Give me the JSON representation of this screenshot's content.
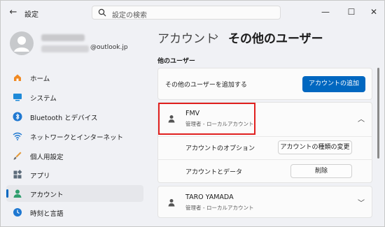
{
  "titlebar": {
    "back_label": "←",
    "app_title": "設定",
    "search_placeholder": "設定の検索",
    "minimize": "—",
    "maximize": "☐",
    "close": "✕"
  },
  "profile": {
    "email_domain": "@outlook.jp"
  },
  "sidebar": {
    "items": [
      {
        "label": "ホーム",
        "icon": "home-icon"
      },
      {
        "label": "システム",
        "icon": "system-icon"
      },
      {
        "label": "Bluetooth とデバイス",
        "icon": "bluetooth-icon"
      },
      {
        "label": "ネットワークとインターネット",
        "icon": "wifi-icon"
      },
      {
        "label": "個人用設定",
        "icon": "brush-icon"
      },
      {
        "label": "アプリ",
        "icon": "apps-icon"
      },
      {
        "label": "アカウント",
        "icon": "account-icon",
        "active": true
      },
      {
        "label": "時刻と言語",
        "icon": "globe-clock-icon"
      }
    ]
  },
  "main": {
    "breadcrumb_parent": "アカウント",
    "breadcrumb_sep": "›",
    "breadcrumb_current": "その他のユーザー",
    "section_title": "他のユーザー",
    "add_user_text": "その他のユーザーを追加する",
    "add_account_button": "アカウントの追加",
    "users": [
      {
        "name": "FMV",
        "role": "管理者 - ローカルアカウント",
        "expanded": true,
        "options_label": "アカウントのオプション",
        "options_button": "アカウントの種類の変更",
        "data_label": "アカウントとデータ",
        "data_button": "削除"
      },
      {
        "name": "TARO YAMADA",
        "role": "管理者 - ローカルアカウント",
        "expanded": false
      }
    ]
  },
  "colors": {
    "accent": "#0067c0",
    "highlight": "#e0201f"
  }
}
